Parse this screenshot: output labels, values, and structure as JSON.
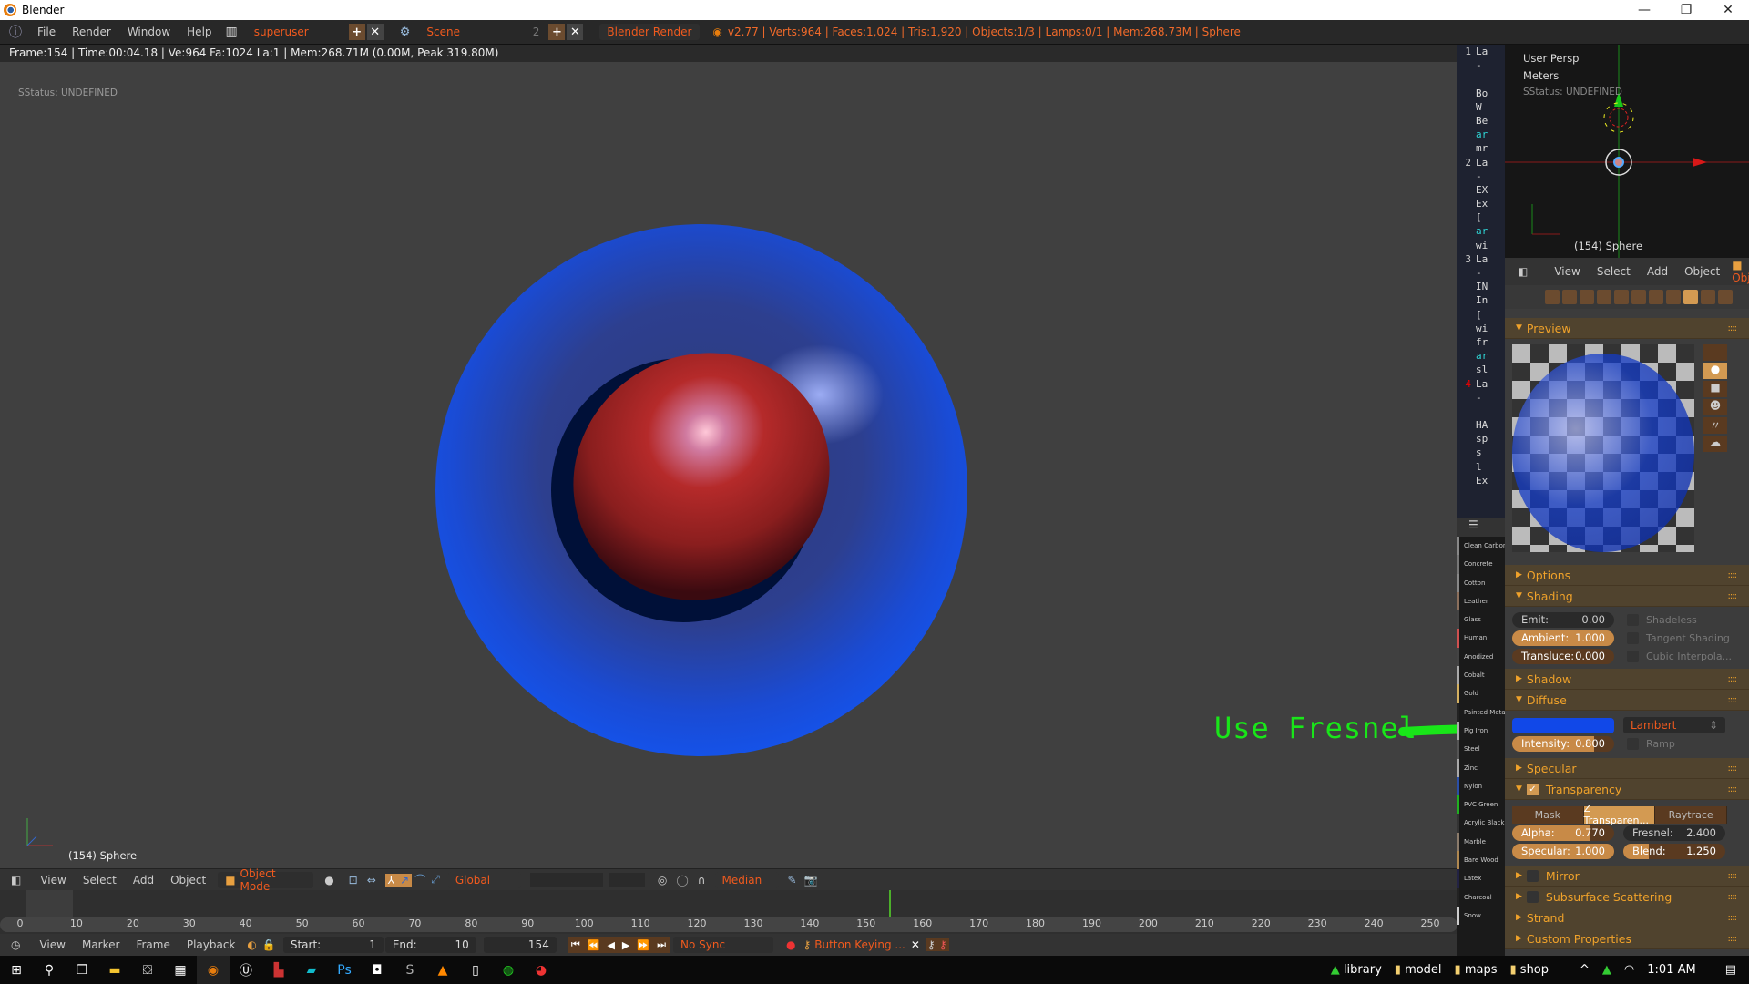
{
  "window": {
    "title": "Blender",
    "minimize": "—",
    "maximize": "❐",
    "close": "✕"
  },
  "menubar": {
    "menus": [
      "File",
      "Render",
      "Window",
      "Help"
    ],
    "screen_layout": "superuser",
    "scene": "Scene",
    "scene_users": "2",
    "render_engine": "Blender Render",
    "stats": "v2.77 | Verts:964 | Faces:1,024 | Tris:1,920 | Objects:1/3 | Lamps:0/1 | Mem:268.73M | Sphere"
  },
  "infobar": {
    "text": "Frame:154 | Time:00:04.18 | Ve:964 Fa:1024 La:1 | Mem:268.71M (0.00M, Peak 319.80M)"
  },
  "viewport": {
    "status": "SStatus: UNDEFINED",
    "object_label": "(154) Sphere",
    "annotation": "Use Fresnel",
    "annotation_color": "#19e619"
  },
  "view3d_header": {
    "menus": [
      "View",
      "Select",
      "Add",
      "Object"
    ],
    "mode": "Object Mode",
    "orientation": "Global",
    "pivot": "Median"
  },
  "timeline": {
    "ticks": [
      "0",
      "10",
      "20",
      "30",
      "40",
      "50",
      "60",
      "70",
      "80",
      "90",
      "100",
      "110",
      "120",
      "130",
      "140",
      "150",
      "160",
      "170",
      "180",
      "190",
      "200",
      "210",
      "220",
      "230",
      "240",
      "250"
    ],
    "current_frame_value": 154,
    "frame_range": [
      0,
      250
    ]
  },
  "timeline_header": {
    "menus": [
      "View",
      "Marker",
      "Frame",
      "Playback"
    ],
    "start_label": "Start:",
    "start": "1",
    "end_label": "End:",
    "end": "10",
    "current": "154",
    "sync": "No Sync",
    "keying": "Button Keying ..."
  },
  "text_editor": {
    "lines": [
      {
        "num": "1",
        "text": "La",
        "color": "normal"
      },
      {
        "num": "",
        "text": " -",
        "color": "normal"
      },
      {
        "num": "",
        "text": "",
        "color": "normal"
      },
      {
        "num": "",
        "text": "Bo",
        "color": "normal"
      },
      {
        "num": "",
        "text": " W",
        "color": "normal"
      },
      {
        "num": "",
        "text": "Be",
        "color": "normal"
      },
      {
        "num": "",
        "text": "ar",
        "color": "cyan"
      },
      {
        "num": "",
        "text": "mr",
        "color": "normal"
      },
      {
        "num": "2",
        "text": "La",
        "color": "normal"
      },
      {
        "num": "",
        "text": " -",
        "color": "normal"
      },
      {
        "num": "",
        "text": "EX",
        "color": "normal"
      },
      {
        "num": "",
        "text": "Ex",
        "color": "normal"
      },
      {
        "num": "",
        "text": " [",
        "color": "normal"
      },
      {
        "num": "",
        "text": "ar",
        "color": "cyan"
      },
      {
        "num": "",
        "text": "wi",
        "color": "normal"
      },
      {
        "num": "3",
        "text": "La",
        "color": "normal"
      },
      {
        "num": "",
        "text": " -",
        "color": "normal"
      },
      {
        "num": "",
        "text": "IN",
        "color": "normal"
      },
      {
        "num": "",
        "text": "In",
        "color": "normal"
      },
      {
        "num": "",
        "text": " [",
        "color": "normal"
      },
      {
        "num": "",
        "text": "wi",
        "color": "normal"
      },
      {
        "num": "",
        "text": "fr",
        "color": "normal"
      },
      {
        "num": "",
        "text": "ar",
        "color": "cyan"
      },
      {
        "num": "",
        "text": "sl",
        "color": "normal"
      },
      {
        "num": "4",
        "text": "La",
        "color": "normal",
        "num_color": "red"
      },
      {
        "num": "",
        "text": " -",
        "color": "normal"
      },
      {
        "num": "",
        "text": "",
        "color": "normal"
      },
      {
        "num": "",
        "text": "HA",
        "color": "normal"
      },
      {
        "num": "",
        "text": "sp",
        "color": "normal"
      },
      {
        "num": "",
        "text": "  s",
        "color": "normal"
      },
      {
        "num": "",
        "text": "  l",
        "color": "normal"
      },
      {
        "num": "",
        "text": "Ex",
        "color": "normal"
      }
    ]
  },
  "material_library": {
    "items": [
      {
        "name": "Clean Carbon",
        "color": "#888"
      },
      {
        "name": "Concrete",
        "color": "#777"
      },
      {
        "name": "Cotton",
        "color": "#888"
      },
      {
        "name": "Leather",
        "color": "#8b6f5c"
      },
      {
        "name": "Glass",
        "color": "#444"
      },
      {
        "name": "Human",
        "color": "#d05050"
      },
      {
        "name": "Anodized",
        "color": "#444"
      },
      {
        "name": "Cobalt",
        "color": "#aaa"
      },
      {
        "name": "Gold",
        "color": "#d4b060"
      },
      {
        "name": "Painted Metal",
        "color": "#222"
      },
      {
        "name": "Pig Iron",
        "color": "#aaa"
      },
      {
        "name": "Steel",
        "color": "#555"
      },
      {
        "name": "Zinc",
        "color": "#aaa"
      },
      {
        "name": "Nylon",
        "color": "#2a4fa8"
      },
      {
        "name": "PVC Green",
        "color": "#20b020"
      },
      {
        "name": "Acrylic Black",
        "color": "#333"
      },
      {
        "name": "Marble",
        "color": "#8b7b6b"
      },
      {
        "name": "Bare Wood",
        "color": "#b08850"
      },
      {
        "name": "Latex",
        "color": "#222244"
      },
      {
        "name": "Charcoal",
        "color": "#222"
      },
      {
        "name": "Snow",
        "color": "#ccc"
      }
    ]
  },
  "top_view": {
    "view_name": "User Persp",
    "units": "Meters",
    "status": "SStatus: UNDEFINED",
    "object_label": "(154) Sphere"
  },
  "properties_header": {
    "menus": [
      "View",
      "Select",
      "Add",
      "Object"
    ],
    "mode": "Object"
  },
  "properties": {
    "preview_label": "Preview",
    "options_label": "Options",
    "shading": {
      "label": "Shading",
      "emit_label": "Emit:",
      "emit": "0.00",
      "ambient_label": "Ambient:",
      "ambient": "1.000",
      "ambient_fraction": 1.0,
      "transluce_label": "Transluce:",
      "transluce": "0.000",
      "transluce_fraction": 0.0,
      "shadeless": "Shadeless",
      "tangent": "Tangent Shading",
      "cubic": "Cubic Interpola..."
    },
    "shadow_label": "Shadow",
    "diffuse": {
      "label": "Diffuse",
      "color": "#1148e8",
      "shader": "Lambert",
      "intensity_label": "Intensity:",
      "intensity": "0.800",
      "intensity_fraction": 0.8,
      "ramp": "Ramp"
    },
    "specular_label": "Specular",
    "transparency": {
      "label": "Transparency",
      "enabled": true,
      "modes": [
        "Mask",
        "Z Transparen...",
        "Raytrace"
      ],
      "active_mode": 1,
      "alpha_label": "Alpha:",
      "alpha": "0.770",
      "alpha_fraction": 0.77,
      "fresnel_label": "Fresnel:",
      "fresnel": "2.400",
      "specular_label": "Specular:",
      "specular": "1.000",
      "specular_fraction": 1.0,
      "blend_label": "Blend:",
      "blend": "1.250",
      "blend_fraction": 0.25
    },
    "mirror_label": "Mirror",
    "sss_label": "Subsurface Scattering",
    "strand_label": "Strand",
    "custom_label": "Custom Properties"
  },
  "taskbar": {
    "pinned": [
      "start",
      "search",
      "task-view",
      "file-explorer",
      "store",
      "calculator",
      "blender",
      "unreal",
      "lightroom",
      "3d-app",
      "photoshop",
      "app-q",
      "substance",
      "vlc",
      "notepad",
      "whatsapp",
      "chrome"
    ],
    "folders": [
      "library",
      "model",
      "maps",
      "shop"
    ],
    "time": "1:01 AM"
  }
}
